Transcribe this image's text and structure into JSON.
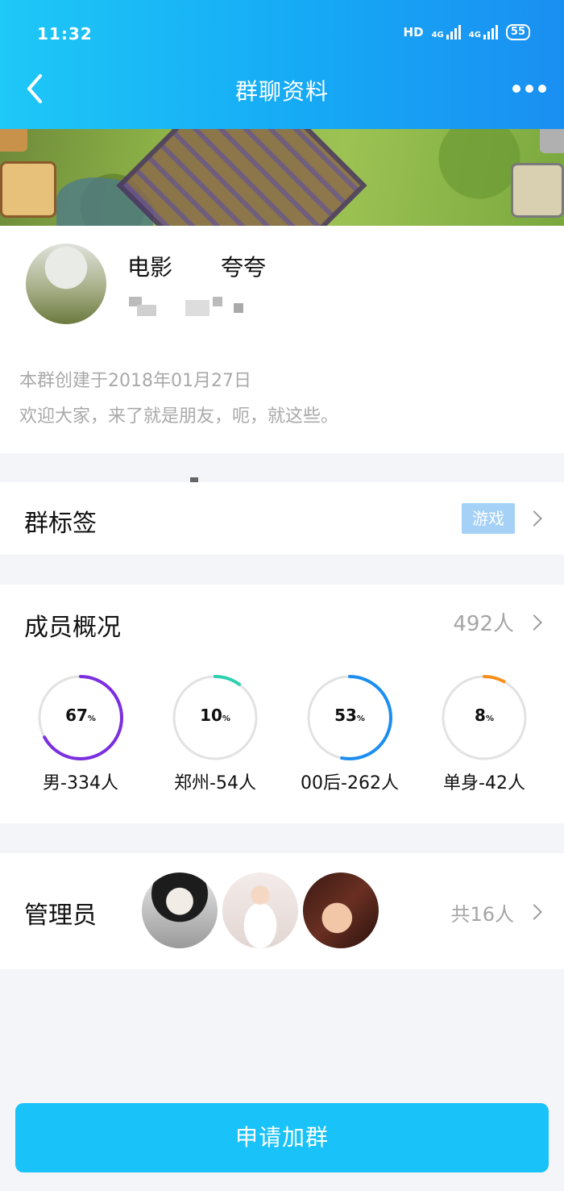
{
  "status_bar": {
    "time": "11:32",
    "hd_label": "HD",
    "sim1_label": "4G",
    "sim2_label": "4G",
    "battery": "55"
  },
  "nav": {
    "title": "群聊资料",
    "back_icon": "chevron-left-icon",
    "more_icon": "more-dots-icon"
  },
  "group": {
    "name": "电影",
    "name_mid": "夸夸",
    "created": "本群创建于2018年01月27日",
    "intro": "欢迎大家，来了就是朋友，呃，就这些。"
  },
  "tags": {
    "label": "群标签",
    "tag": "游戏"
  },
  "members": {
    "label": "成员概况",
    "count": "492人",
    "stats": [
      {
        "pct": "67",
        "unit": "%",
        "label": "男-334人",
        "fraction": 0.67,
        "color": "#7b2fe0"
      },
      {
        "pct": "10",
        "unit": "%",
        "label": "郑州-54人",
        "fraction": 0.1,
        "color": "#2fd0b0"
      },
      {
        "pct": "53",
        "unit": "%",
        "label": "00后-262人",
        "fraction": 0.53,
        "color": "#1c8ef0"
      },
      {
        "pct": "8",
        "unit": "%",
        "label": "单身-42人",
        "fraction": 0.08,
        "color": "#f5901e"
      }
    ]
  },
  "admins": {
    "label": "管理员",
    "count": "共16人"
  },
  "actions": {
    "apply": "申请加群"
  },
  "colors": {
    "header_start": "#1ec8f7",
    "header_end": "#1a8ff2",
    "primary_button": "#19c2f8",
    "tag_chip": "#a5d1f7"
  }
}
